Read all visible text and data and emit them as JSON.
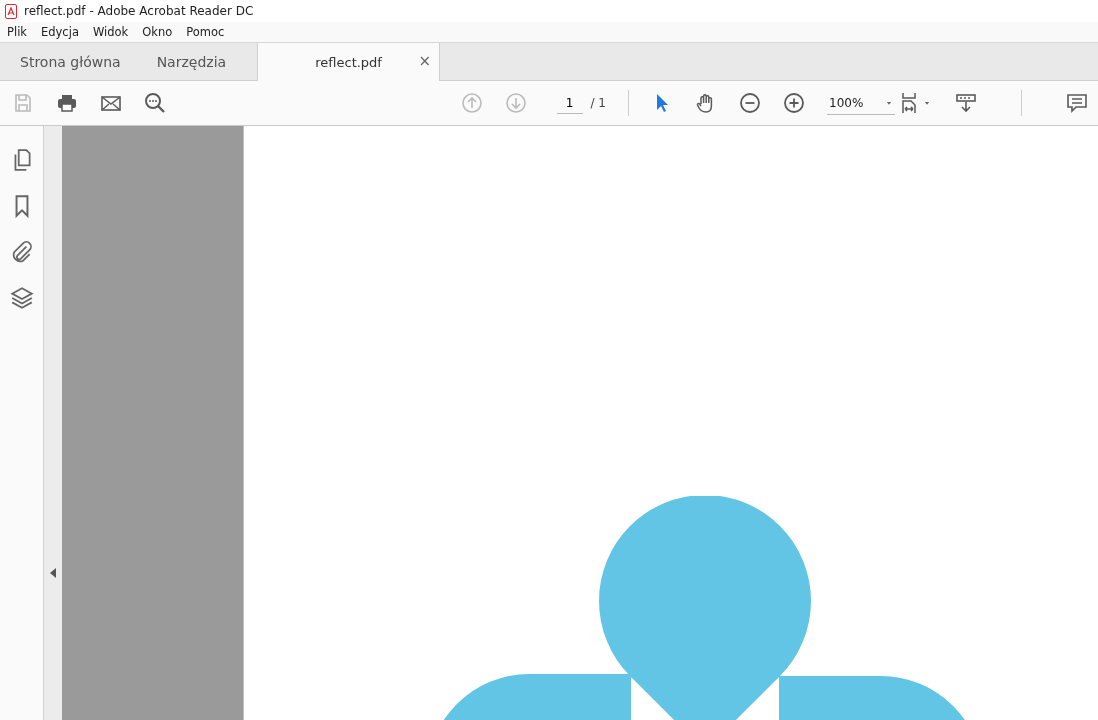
{
  "window": {
    "title": "reflect.pdf - Adobe Acrobat Reader DC"
  },
  "menu": [
    "Plik",
    "Edycja",
    "Widok",
    "Okno",
    "Pomoc"
  ],
  "tabs": [
    {
      "label": "Strona główna",
      "selected": false,
      "kind": "nav"
    },
    {
      "label": "Narzędzia",
      "selected": false,
      "kind": "nav"
    },
    {
      "label": "reflect.pdf",
      "selected": true,
      "kind": "document",
      "close": "×"
    }
  ],
  "toolbar": {
    "left": [
      {
        "kind": "save",
        "disabled": true
      },
      {
        "kind": "print",
        "disabled": false
      },
      {
        "kind": "mail",
        "disabled": false
      },
      {
        "kind": "search",
        "disabled": false
      }
    ],
    "nav": [
      {
        "kind": "up",
        "disabled": true
      },
      {
        "kind": "down",
        "disabled": true
      }
    ],
    "page_number": "1",
    "page_total": "/ 1",
    "tools": [
      {
        "kind": "cursor",
        "selected": true
      },
      {
        "kind": "hand",
        "selected": false
      },
      {
        "kind": "zoom-out",
        "selected": false
      },
      {
        "kind": "zoom-in",
        "selected": false
      }
    ],
    "zoom": "100%",
    "right": [
      {
        "kind": "fit"
      },
      {
        "kind": "scroll"
      },
      {
        "kind": "comment"
      }
    ]
  },
  "sidebar": [
    {
      "kind": "pages"
    },
    {
      "kind": "bookmark"
    },
    {
      "kind": "attachment"
    },
    {
      "kind": "layers"
    }
  ]
}
